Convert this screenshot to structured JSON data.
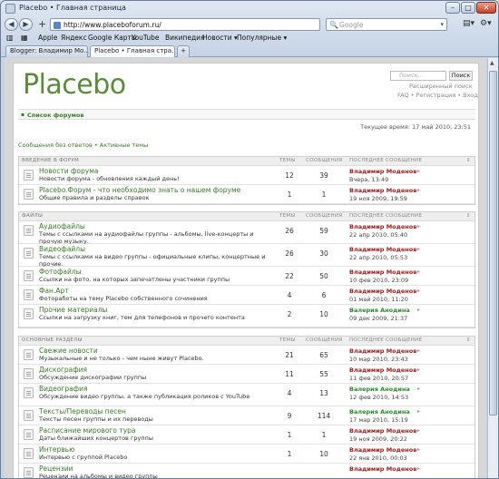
{
  "window": {
    "title": "Placebo • Главная страница",
    "min": "–",
    "max": "□",
    "close": "✕"
  },
  "nav": {
    "back": "◀",
    "forward": "▶",
    "add": "+",
    "url": "http://www.placeboforum.ru/",
    "search_placeholder": "Google",
    "search_glyph": "🔍"
  },
  "bookmarks": [
    "Apple",
    "Яндекс",
    "Google Карты",
    "YouTube",
    "Википедия",
    "Новости ▾",
    "Популярные ▾"
  ],
  "tabs": [
    "Blogger: Владимир Мо...",
    "Placebo • Главная стра...",
    "+"
  ],
  "page": {
    "logo": "Placebo",
    "search_placeholder": "Поиск...",
    "search_button": "Поиск",
    "advanced_search": "Расширенный поиск",
    "top_links": "FAQ • Регистрация • Вход",
    "breadcrumb": "Список форумов",
    "current_time": "Текущее время: 17 май 2010, 23:51",
    "quick_links": "Сообщения без ответов • Активные темы",
    "col_topics": "ТЕМЫ",
    "col_posts": "СООБЩЕНИЯ",
    "col_last": "ПОСЛЕДНЕЕ СООБЩЕНИЕ"
  },
  "categories": [
    {
      "name": "ВВЕДЕНИЕ В ФОРУМ",
      "forums": [
        {
          "title": "Новости форума",
          "desc": "Новости форума - обновления каждый день!",
          "topics": "12",
          "posts": "39",
          "author": "Владимир Моденов",
          "date": "Вчера, 13:49"
        },
        {
          "title": "Placebo.Форум - что необходимо знать о нашем форуме",
          "desc": "Общие правила и разделы справок",
          "topics": "1",
          "posts": "1",
          "author": "Владимир Моденов",
          "date": "19 ноя 2009, 19:59"
        }
      ]
    },
    {
      "name": "ФАЙЛЫ",
      "forums": [
        {
          "title": "Аудиофайлы",
          "desc": "Темы с ссылками на аудиофайлы группы - альбомы, live-концерты и прочую музыку.",
          "topics": "26",
          "posts": "59",
          "author": "Владимир Моденов",
          "date": "22 апр 2010, 05:40"
        },
        {
          "title": "Видеофайлы",
          "desc": "Темы с ссылками на видео группы - официальные клипы, концертные и прочие.",
          "topics": "26",
          "posts": "30",
          "author": "Владимир Моденов",
          "date": "22 апр 2010, 05:53"
        },
        {
          "title": "Фотофайлы",
          "desc": "Ссылки на фото, на которых запечатлены участники группы",
          "topics": "22",
          "posts": "50",
          "author": "Владимир Моденов",
          "date": "10 фев 2010, 23:09"
        },
        {
          "title": "Фан.Арт",
          "desc": "Фотоработы на тему Placebo собственного сочинения",
          "topics": "4",
          "posts": "6",
          "author": "Владимир Моденов",
          "date": "01 май 2010, 11:20"
        },
        {
          "title": "Прочие материалы",
          "desc": "Ссылки на загрузку книг, тем для телефонов и прочего контента",
          "topics": "2",
          "posts": "10",
          "author": "Валерия Анодина",
          "date": "09 дек 2009, 21:37",
          "green": true
        }
      ]
    },
    {
      "name": "ОСНОВНЫЕ РАЗДЕЛЫ",
      "forums": [
        {
          "title": "Свежие новости",
          "desc": "Музыкальные и не только - чем ныне живут Placebo.",
          "topics": "21",
          "posts": "65",
          "author": "Владимир Моденов",
          "date": "10 мар 2010, 23:43"
        },
        {
          "title": "Дискография",
          "desc": "Обсуждение дискографии группы",
          "topics": "11",
          "posts": "55",
          "author": "Владимир Моденов",
          "date": "11 фев 2010, 20:57"
        },
        {
          "title": "Видеография",
          "desc": "Обсуждение видео группы, а также публикация роликов с YouTube",
          "topics": "4",
          "posts": "13",
          "author": "Валерия Анодина",
          "date": "12 фев 2010, 14:53",
          "green": true
        },
        {
          "title": "Тексты/Переводы песен",
          "desc": "Тексты песен группы и их переводы",
          "topics": "9",
          "posts": "114",
          "author": "Валерия Анодина",
          "date": "17 мар 2010, 15:19",
          "green": true
        },
        {
          "title": "Расписание мирового тура",
          "desc": "Даты ближайших концертов группы",
          "topics": "1",
          "posts": "1",
          "author": "Владимир Моденов",
          "date": "19 ноя 2009, 20:22"
        },
        {
          "title": "Интервью",
          "desc": "Интервью с группой Placebo",
          "topics": "1",
          "posts": "10",
          "author": "Владимир Моденов",
          "date": "22 янв 2010, 00:03"
        },
        {
          "title": "Рецензии",
          "desc": "Рецензии на альбомы и видео группы",
          "topics": "",
          "posts": "",
          "author": "Владимир Моденов",
          "date": ""
        }
      ]
    }
  ],
  "colors": {
    "green_link": "#3a7a2a",
    "author_red": "#a01c1c",
    "author_green": "#2a8a2a",
    "logo": "#5d8a3c"
  },
  "icons": [
    "back-icon",
    "forward-icon",
    "search-icon",
    "rss-icon",
    "page-icon",
    "gear-icon",
    "forum-icon",
    "go-to-last-post-icon"
  ]
}
